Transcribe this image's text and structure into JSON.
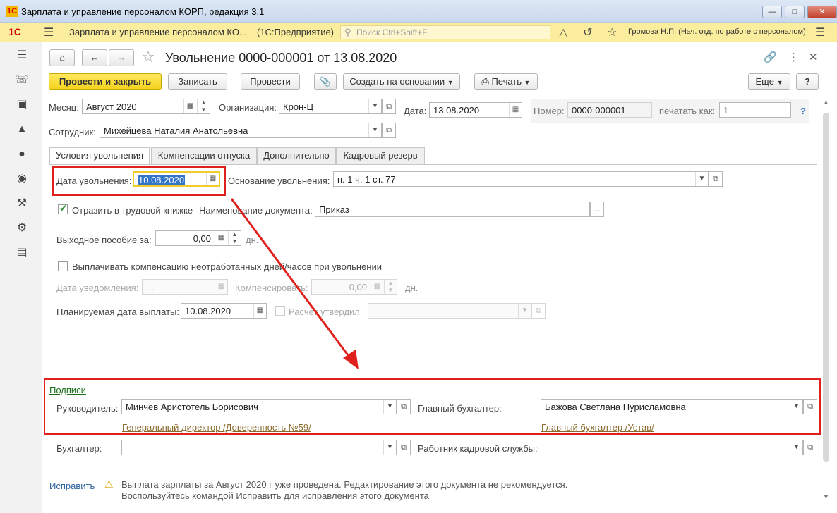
{
  "window": {
    "title": "Зарплата и управление персоналом КОРП, редакция 3.1",
    "logo": "1С"
  },
  "apptoolbar": {
    "logo": "1С",
    "app_name": "Зарплата и управление персоналом КО...",
    "platform": "(1С:Предприятие)",
    "search_placeholder": "Поиск Ctrl+Shift+F",
    "user": "Громова Н.П. (Нач. отд. по работе с персоналом)"
  },
  "document": {
    "title": "Увольнение 0000-000001 от 13.08.2020"
  },
  "commands": {
    "post_close": "Провести и закрыть",
    "save": "Записать",
    "post": "Провести",
    "create_based": "Создать на основании",
    "print": "Печать",
    "more": "Еще",
    "help": "?"
  },
  "header_fields": {
    "month_label": "Месяц:",
    "month_value": "Август 2020",
    "org_label": "Организация:",
    "org_value": "Крон-Ц",
    "date_label": "Дата:",
    "date_value": "13.08.2020",
    "number_label": "Номер:",
    "number_value": "0000-000001",
    "print_as_label": "печатать как:",
    "print_as_value": "1",
    "print_as_help": "?",
    "employee_label": "Сотрудник:",
    "employee_value": "Михейцева Наталия Анатольевна"
  },
  "tabs": [
    {
      "label": "Условия увольнения"
    },
    {
      "label": "Компенсации отпуска"
    },
    {
      "label": "Дополнительно"
    },
    {
      "label": "Кадровый резерв"
    }
  ],
  "conditions": {
    "dismissal_date_label": "Дата увольнения:",
    "dismissal_date_value": "10.08.2020",
    "basis_label": "Основание увольнения:",
    "basis_value": "п. 1 ч. 1 ст. 77",
    "workbook_label": "Отразить в трудовой книжке",
    "doc_name_label": "Наименование документа:",
    "doc_name_value": "Приказ",
    "doc_name_btn": "...",
    "severance_label": "Выходное пособие за:",
    "severance_value": "0,00",
    "severance_unit": "дн.",
    "pay_comp_label": "Выплачивать компенсацию неотработанных дней/часов при увольнении",
    "notice_date_label": "Дата уведомления:",
    "notice_date_value": " .  .",
    "compensate_label": "Компенсировать:",
    "compensate_value": "0,00",
    "compensate_unit": "дн.",
    "planned_pay_label": "Планируемая дата выплаты:",
    "planned_pay_value": "10.08.2020",
    "approved_label": "Расчет утвердил"
  },
  "signatures": {
    "section_label": "Подписи",
    "head_label": "Руководитель:",
    "head_value": "Минчев Аристотель Борисович",
    "head_position": "Генеральный директор  /Доверенность №59/",
    "chief_acc_label": "Главный бухгалтер:",
    "chief_acc_value": "Бажова Светлана Нурисламовна",
    "chief_acc_position": "Главный бухгалтер  /Устав/",
    "accountant_label": "Бухгалтер:",
    "hr_label": "Работник кадровой службы:"
  },
  "warning": {
    "fix_link": "Исправить",
    "line1": "Выплата зарплаты за Август 2020 г уже проведена. Редактирование этого документа не рекомендуется.",
    "line2": "Воспользуйтесь командой Исправить для исправления этого документа"
  },
  "colors": {
    "accent_yellow": "#f4d21b",
    "highlight_red": "#e0201c",
    "link_green": "#1a6e1a"
  }
}
